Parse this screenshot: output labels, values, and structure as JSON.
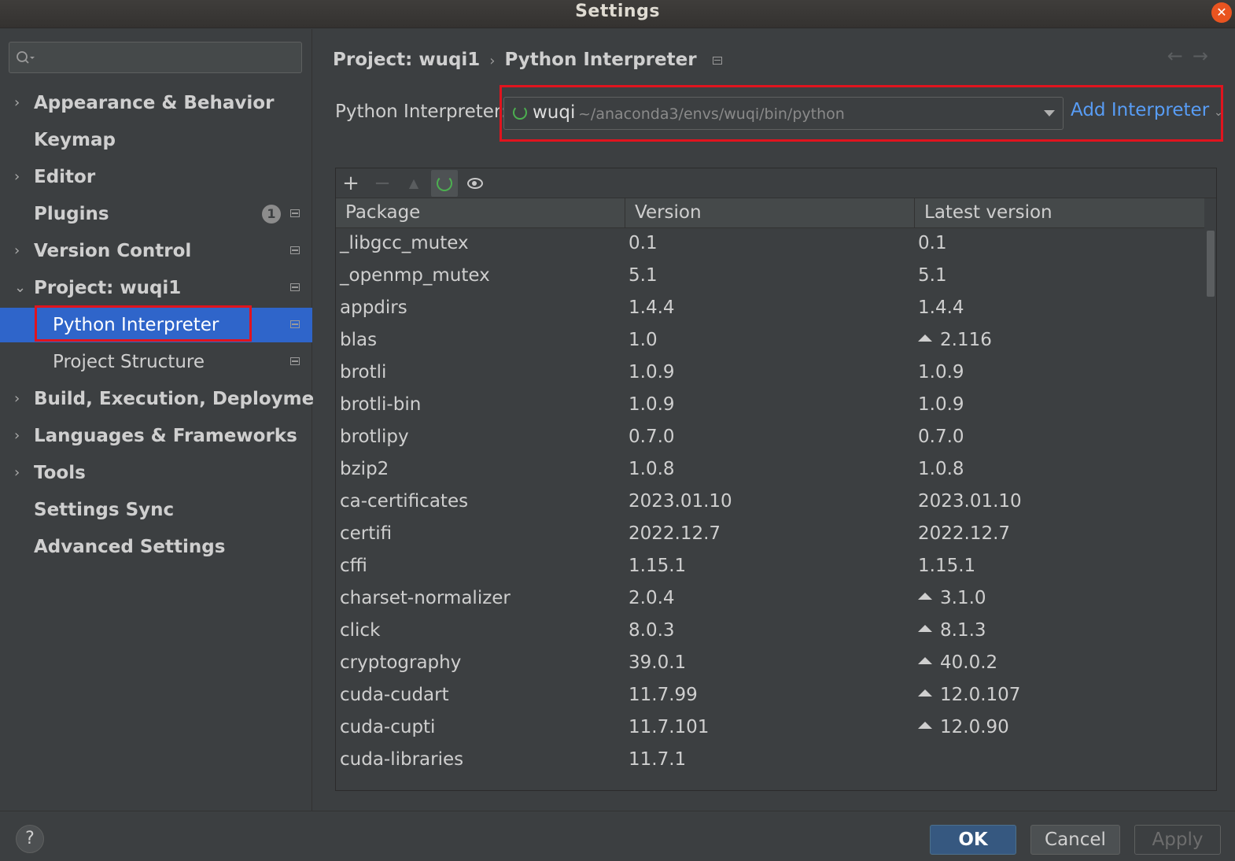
{
  "window": {
    "title": "Settings",
    "close_symbol": "✕"
  },
  "sidebar": {
    "search": {
      "placeholder": ""
    },
    "items": [
      {
        "label": "Appearance & Behavior",
        "chevron": "›"
      },
      {
        "label": "Keymap",
        "chevron": ""
      },
      {
        "label": "Editor",
        "chevron": "›"
      },
      {
        "label": "Plugins",
        "chevron": "",
        "badge": "1"
      },
      {
        "label": "Version Control",
        "chevron": "›"
      },
      {
        "label": "Project: wuqi1",
        "chevron": "⌄"
      },
      {
        "label": "Python Interpreter",
        "selected": true
      },
      {
        "label": "Project Structure"
      },
      {
        "label": "Build, Execution, Deployment",
        "chevron": "›"
      },
      {
        "label": "Languages & Frameworks",
        "chevron": "›"
      },
      {
        "label": "Tools",
        "chevron": "›"
      },
      {
        "label": "Settings Sync",
        "chevron": ""
      },
      {
        "label": "Advanced Settings",
        "chevron": ""
      }
    ]
  },
  "main": {
    "breadcrumb": {
      "project": "Project: wuqi1",
      "separator": "›",
      "page": "Python Interpreter"
    },
    "nav": {
      "back": "←",
      "forward": "→"
    },
    "interpreter": {
      "label": "Python Interpreter:",
      "name": "wuqi",
      "path": "~/anaconda3/envs/wuqi/bin/python",
      "add_label": "Add Interpreter",
      "add_caret": "⌄"
    },
    "toolbar": {
      "add": "+",
      "remove": "−",
      "upgrade": "▲"
    },
    "table": {
      "headers": [
        "Package",
        "Version",
        "Latest version"
      ],
      "rows": [
        {
          "package": "_libgcc_mutex",
          "version": "0.1",
          "latest": "0.1",
          "upgrade": false
        },
        {
          "package": "_openmp_mutex",
          "version": "5.1",
          "latest": "5.1",
          "upgrade": false
        },
        {
          "package": "appdirs",
          "version": "1.4.4",
          "latest": "1.4.4",
          "upgrade": false
        },
        {
          "package": "blas",
          "version": "1.0",
          "latest": "2.116",
          "upgrade": true
        },
        {
          "package": "brotli",
          "version": "1.0.9",
          "latest": "1.0.9",
          "upgrade": false
        },
        {
          "package": "brotli-bin",
          "version": "1.0.9",
          "latest": "1.0.9",
          "upgrade": false
        },
        {
          "package": "brotlipy",
          "version": "0.7.0",
          "latest": "0.7.0",
          "upgrade": false
        },
        {
          "package": "bzip2",
          "version": "1.0.8",
          "latest": "1.0.8",
          "upgrade": false
        },
        {
          "package": "ca-certificates",
          "version": "2023.01.10",
          "latest": "2023.01.10",
          "upgrade": false
        },
        {
          "package": "certifi",
          "version": "2022.12.7",
          "latest": "2022.12.7",
          "upgrade": false
        },
        {
          "package": "cffi",
          "version": "1.15.1",
          "latest": "1.15.1",
          "upgrade": false
        },
        {
          "package": "charset-normalizer",
          "version": "2.0.4",
          "latest": "3.1.0",
          "upgrade": true
        },
        {
          "package": "click",
          "version": "8.0.3",
          "latest": "8.1.3",
          "upgrade": true
        },
        {
          "package": "cryptography",
          "version": "39.0.1",
          "latest": "40.0.2",
          "upgrade": true
        },
        {
          "package": "cuda-cudart",
          "version": "11.7.99",
          "latest": "12.0.107",
          "upgrade": true
        },
        {
          "package": "cuda-cupti",
          "version": "11.7.101",
          "latest": "12.0.90",
          "upgrade": true
        },
        {
          "package": "cuda-libraries",
          "version": "11.7.1",
          "latest": "",
          "upgrade": false
        }
      ]
    }
  },
  "footer": {
    "help": "?",
    "ok": "OK",
    "cancel": "Cancel",
    "apply": "Apply"
  },
  "colors": {
    "accent": "#2f65ca",
    "link": "#589df6",
    "highlight_box": "#e0141e",
    "ok_button": "#365880"
  }
}
